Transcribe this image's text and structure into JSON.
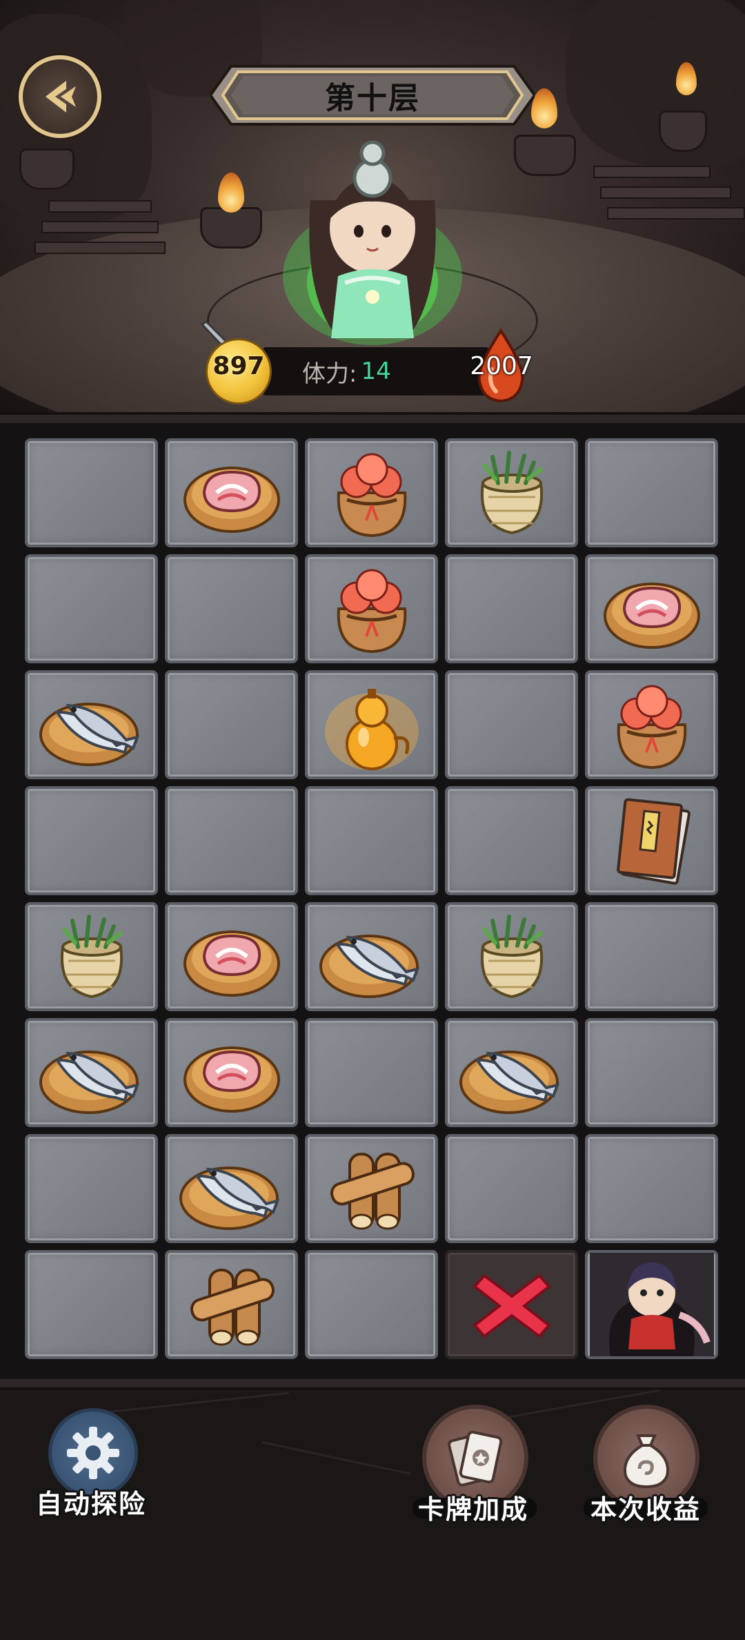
{
  "header": {
    "title": "第十层"
  },
  "stats": {
    "gold": "897",
    "stamina_label": "体力:",
    "stamina_value": "14",
    "blood": "2007"
  },
  "board": {
    "rows": [
      [
        "empty",
        "meat",
        "peach-bag",
        "herb-basket",
        "empty"
      ],
      [
        "empty",
        "empty",
        "peach-bag",
        "empty",
        "meat"
      ],
      [
        "fish",
        "empty",
        "gourd",
        "empty",
        "peach-bag"
      ],
      [
        "empty",
        "empty",
        "empty",
        "empty",
        "book"
      ],
      [
        "herb-basket",
        "meat",
        "fish",
        "herb-basket",
        "empty"
      ],
      [
        "fish",
        "meat",
        "empty",
        "fish",
        "empty"
      ],
      [
        "empty",
        "fish",
        "wood",
        "empty",
        "empty"
      ],
      [
        "empty",
        "wood",
        "empty",
        "exit-x",
        "character"
      ]
    ]
  },
  "controls": {
    "auto_explore": "自动探险",
    "card_bonus": "卡牌加成",
    "this_income": "本次收益"
  },
  "icons": {
    "back": "back-arrow-icon",
    "auto": "gear-icon",
    "card": "card-icon",
    "bag": "money-bag-icon"
  },
  "colors": {
    "stamina_value": "#47d49a",
    "banner_border": "#e2c690",
    "exit_x": "#e8334a"
  }
}
